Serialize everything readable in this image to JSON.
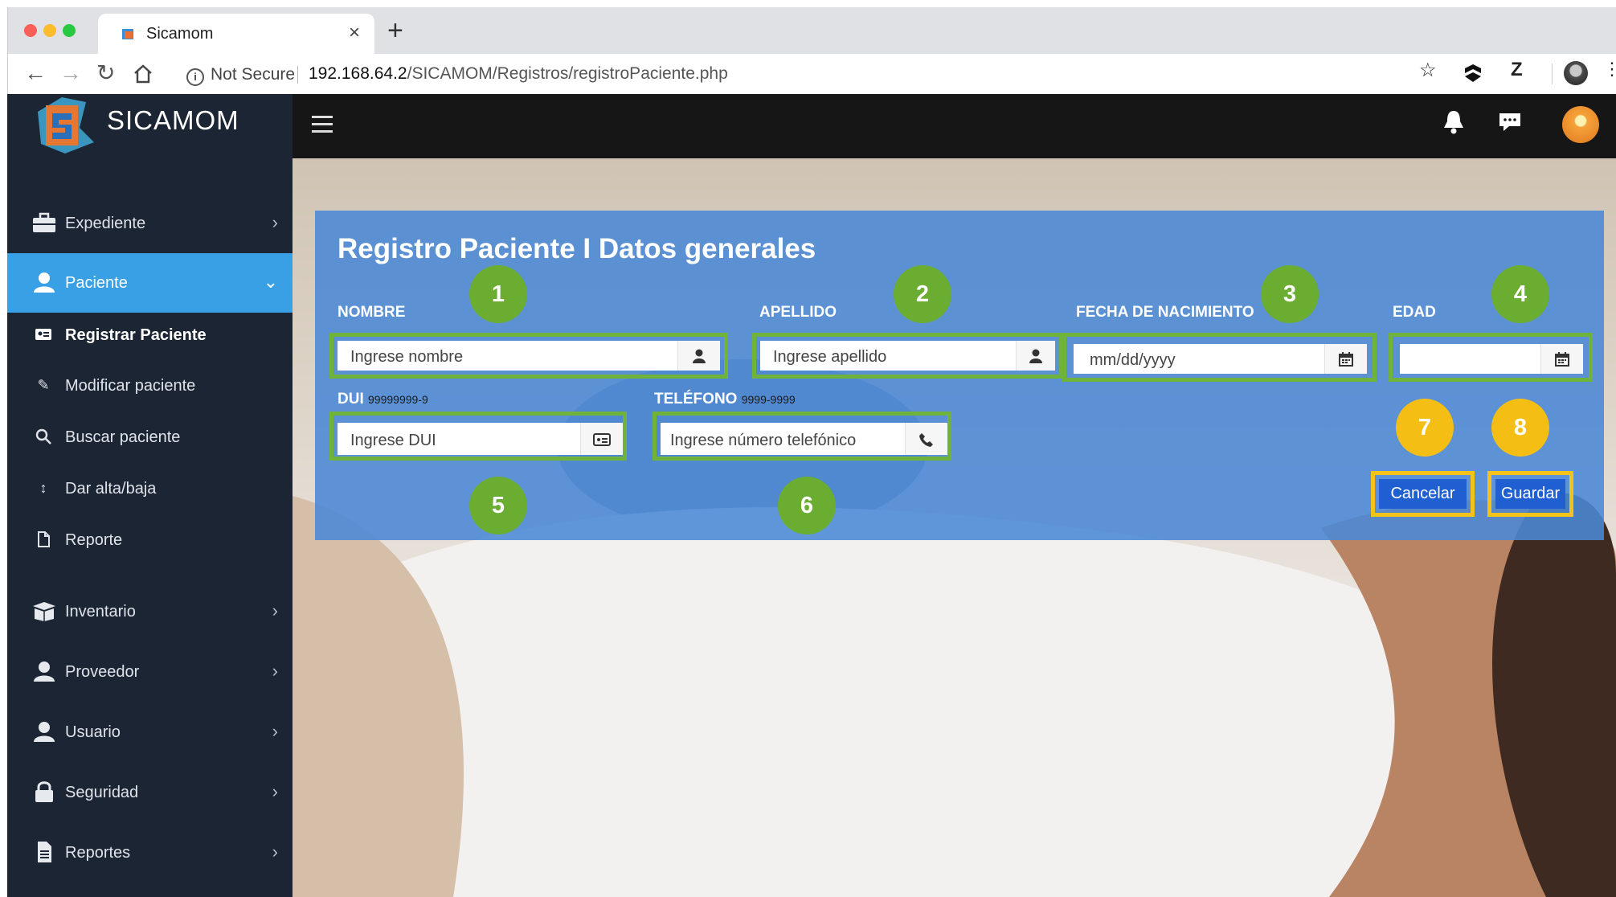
{
  "browser": {
    "tab_title": "Sicamom",
    "new_tab": "+",
    "close_tab": "×",
    "security_label": "Not Secure",
    "url_host": "192.168.64.2",
    "url_path": "/SICAMOM/Registros/registroPaciente.php",
    "extensions": [
      "Z"
    ]
  },
  "app": {
    "logo_text": "SICAMOM"
  },
  "sidebar": {
    "items": [
      {
        "label": "Expediente",
        "icon": "briefcase-icon"
      },
      {
        "label": "Paciente",
        "icon": "user-icon",
        "active": true
      },
      {
        "label": "Inventario",
        "icon": "box-icon"
      },
      {
        "label": "Proveedor",
        "icon": "user-icon"
      },
      {
        "label": "Usuario",
        "icon": "user-icon"
      },
      {
        "label": "Seguridad",
        "icon": "lock-icon"
      },
      {
        "label": "Reportes",
        "icon": "document-icon"
      }
    ],
    "sub_items": [
      {
        "label": "Registrar Paciente",
        "icon": "id-card-icon"
      },
      {
        "label": "Modificar paciente",
        "icon": "pencil-icon"
      },
      {
        "label": "Buscar paciente",
        "icon": "search-icon"
      },
      {
        "label": "Dar alta/baja",
        "icon": "arrows-vertical-icon"
      },
      {
        "label": "Reporte",
        "icon": "file-icon"
      }
    ]
  },
  "form": {
    "title": "Registro Paciente I Datos generales",
    "nombre": {
      "label": "NOMBRE",
      "placeholder": "Ingrese nombre"
    },
    "apellido": {
      "label": "APELLIDO",
      "placeholder": "Ingrese apellido"
    },
    "fecha": {
      "label": "FECHA DE NACIMIENTO",
      "placeholder": "mm/dd/yyyy"
    },
    "edad": {
      "label": "EDAD",
      "value": ""
    },
    "dui": {
      "label": "DUI",
      "hint": "99999999-9",
      "placeholder": "Ingrese DUI"
    },
    "telefono": {
      "label": "TELÉFONO",
      "hint": "9999-9999",
      "placeholder": "Ingrese número telefónico"
    },
    "cancel_label": "Cancelar",
    "save_label": "Guardar"
  },
  "annotations": [
    "1",
    "2",
    "3",
    "4",
    "5",
    "6",
    "7",
    "8"
  ],
  "colors": {
    "sidebar_bg": "#1c2533",
    "active_item": "#3aa0e6",
    "panel_blue": "#4a89d6",
    "highlight_green": "#6fb33a",
    "highlight_yellow": "#f4c31a",
    "button_blue": "#1f5fd1"
  }
}
